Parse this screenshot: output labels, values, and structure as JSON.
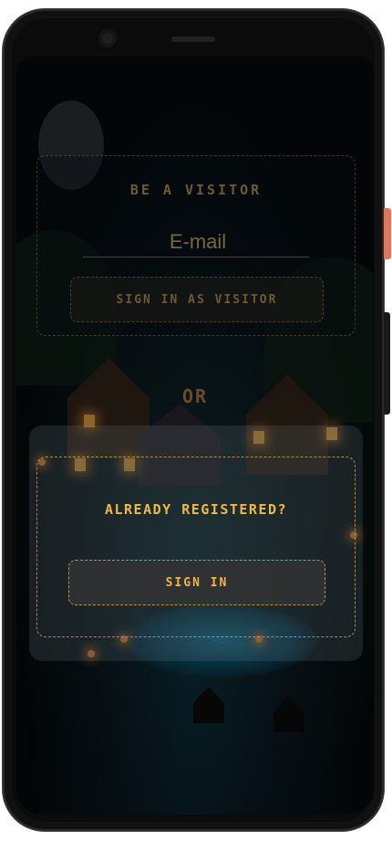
{
  "visitor_card": {
    "title": "BE A VISITOR",
    "email_placeholder": "E-mail",
    "button_label": "SIGN IN AS VISITOR"
  },
  "divider": {
    "label": "OR"
  },
  "register_card": {
    "title": "ALREADY REGISTERED?",
    "button_label": "SIGN IN"
  },
  "colors": {
    "accent": "#f0b84a",
    "muted_accent": "#6e5b2f",
    "phone_button": "#e5735c"
  }
}
